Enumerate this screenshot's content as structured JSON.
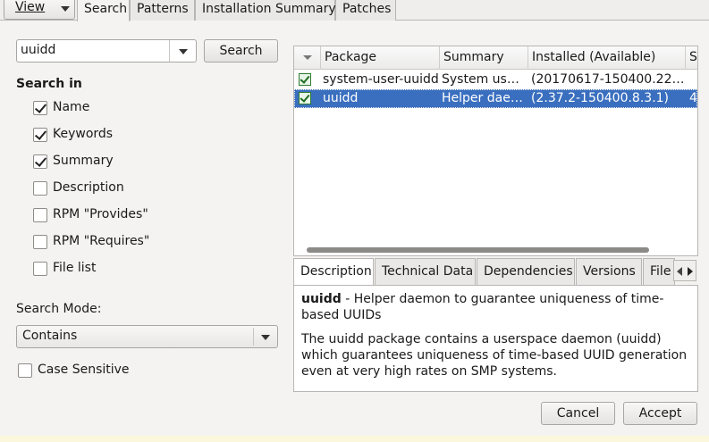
{
  "topbar": {
    "view_label": "View",
    "tabs": [
      {
        "label": "Search",
        "active": true
      },
      {
        "label": "Patterns",
        "active": false
      },
      {
        "label": "Installation Summary",
        "active": false
      },
      {
        "label": "Patches",
        "active": false
      }
    ]
  },
  "search": {
    "query": "uuidd",
    "button_label": "Search",
    "search_in_label": "Search in",
    "options": [
      {
        "label": "Name",
        "checked": true
      },
      {
        "label": "Keywords",
        "checked": true
      },
      {
        "label": "Summary",
        "checked": true
      },
      {
        "label": "Description",
        "checked": false
      },
      {
        "label": "RPM \"Provides\"",
        "checked": false
      },
      {
        "label": "RPM \"Requires\"",
        "checked": false
      },
      {
        "label": "File list",
        "checked": false
      }
    ],
    "mode_label": "Search Mode:",
    "mode_value": "Contains",
    "case_label": "Case Sensitive"
  },
  "table": {
    "columns": [
      "",
      "Package",
      "Summary",
      "Installed (Available)",
      "Si"
    ],
    "rows": [
      {
        "package": "system-user-uuidd",
        "summary": "System use…",
        "installed": "(20170617-150400.22.…",
        "size": "",
        "selected": false
      },
      {
        "package": "uuidd",
        "summary": "Helper dae…",
        "installed": "(2.37.2-150400.8.3.1)",
        "size": "4",
        "selected": true
      }
    ]
  },
  "detail": {
    "tabs": [
      {
        "label": "Description",
        "active": true
      },
      {
        "label": "Technical Data",
        "active": false
      },
      {
        "label": "Dependencies",
        "active": false
      },
      {
        "label": "Versions",
        "active": false
      },
      {
        "label": "File",
        "active": false
      }
    ],
    "package_name": "uuidd",
    "summary_line": " - Helper daemon to guarantee uniqueness of time-based UUIDs",
    "body": "The uuidd package contains a userspace daemon (uuidd) which guarantees uniqueness of time-based UUID generation even at very high rates on SMP systems."
  },
  "buttons": {
    "cancel": "Cancel",
    "accept": "Accept"
  },
  "colors": {
    "selection": "#3a6fbf",
    "installed_icon": "#2f7a2f"
  }
}
